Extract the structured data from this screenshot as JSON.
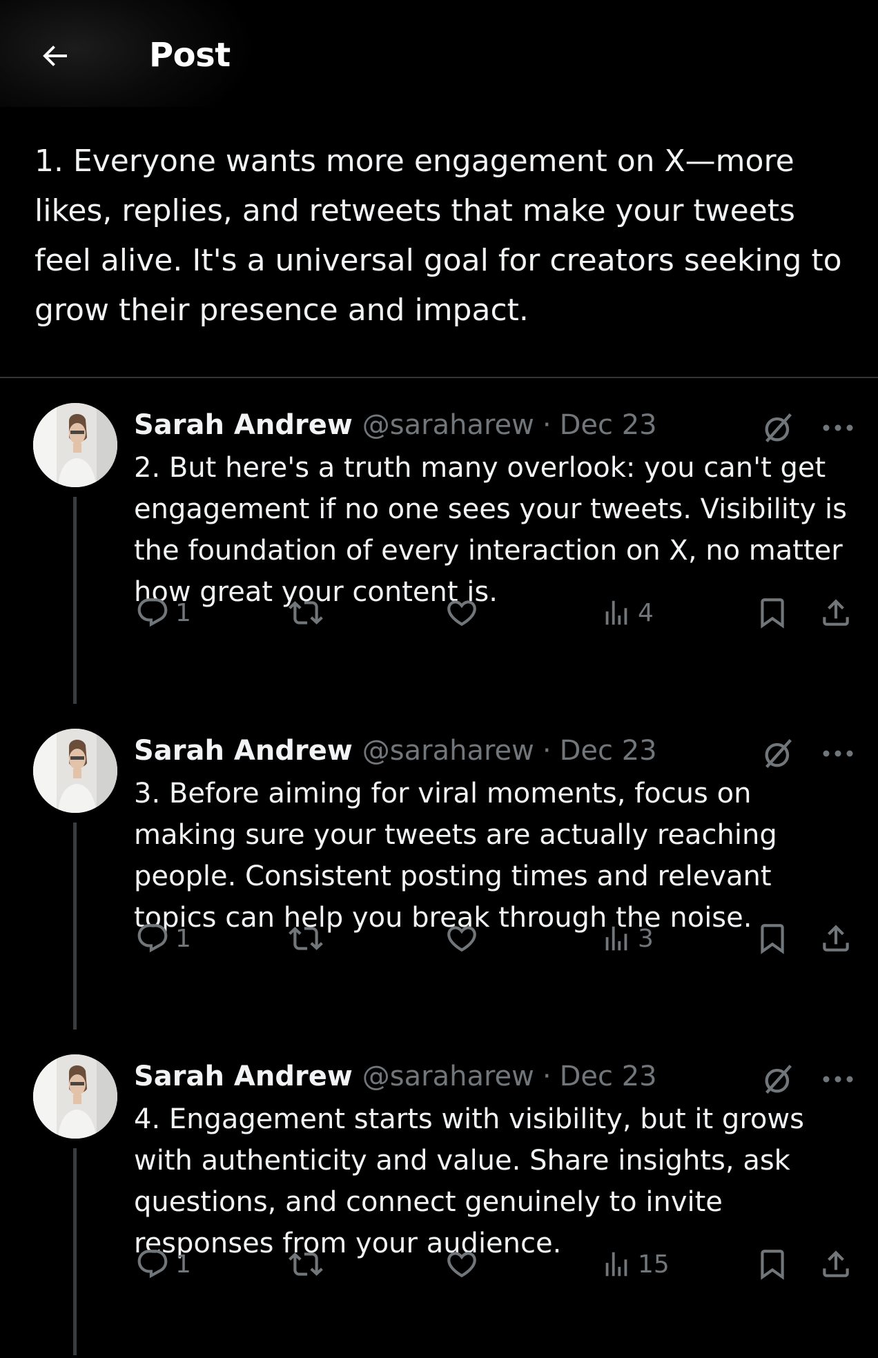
{
  "header": {
    "title": "Post",
    "back_icon": "arrow-left-icon"
  },
  "main_post": {
    "text": "1. Everyone wants more engagement on X—more likes, replies, and retweets that make your tweets feel alive. It's a universal goal for creators seeking to grow their presence and impact."
  },
  "replies": [
    {
      "name": "Sarah Andrew",
      "handle": "@saraharew",
      "separator": "·",
      "date": "Dec 23",
      "text": "2. But here's a truth many overlook: you can't get engagement if no one sees your tweets. Visibility is the foundation of every interaction on X, no matter how great your content is.",
      "reply_count": "1",
      "view_count": "4"
    },
    {
      "name": "Sarah Andrew",
      "handle": "@saraharew",
      "separator": "·",
      "date": "Dec 23",
      "text": "3. Before aiming for viral moments, focus on making sure your tweets are actually reaching people. Consistent posting times and relevant topics can help you break through the noise.",
      "reply_count": "1",
      "view_count": "3"
    },
    {
      "name": "Sarah Andrew",
      "handle": "@saraharew",
      "separator": "·",
      "date": "Dec 23",
      "text": "4. Engagement starts with visibility, but it grows with authenticity and value. Share insights, ask questions, and connect genuinely to invite responses from your audience.",
      "reply_count": "1",
      "view_count": "15"
    }
  ],
  "icons": {
    "reply": "reply-icon",
    "retweet": "retweet-icon",
    "like": "heart-icon",
    "views": "views-chart-icon",
    "bookmark": "bookmark-icon",
    "share": "share-icon",
    "grok": "grok-icon",
    "more": "more-dots-icon"
  },
  "colors": {
    "background": "#000000",
    "text": "#e7e9ea",
    "muted": "#71767b",
    "divider": "#333639"
  }
}
